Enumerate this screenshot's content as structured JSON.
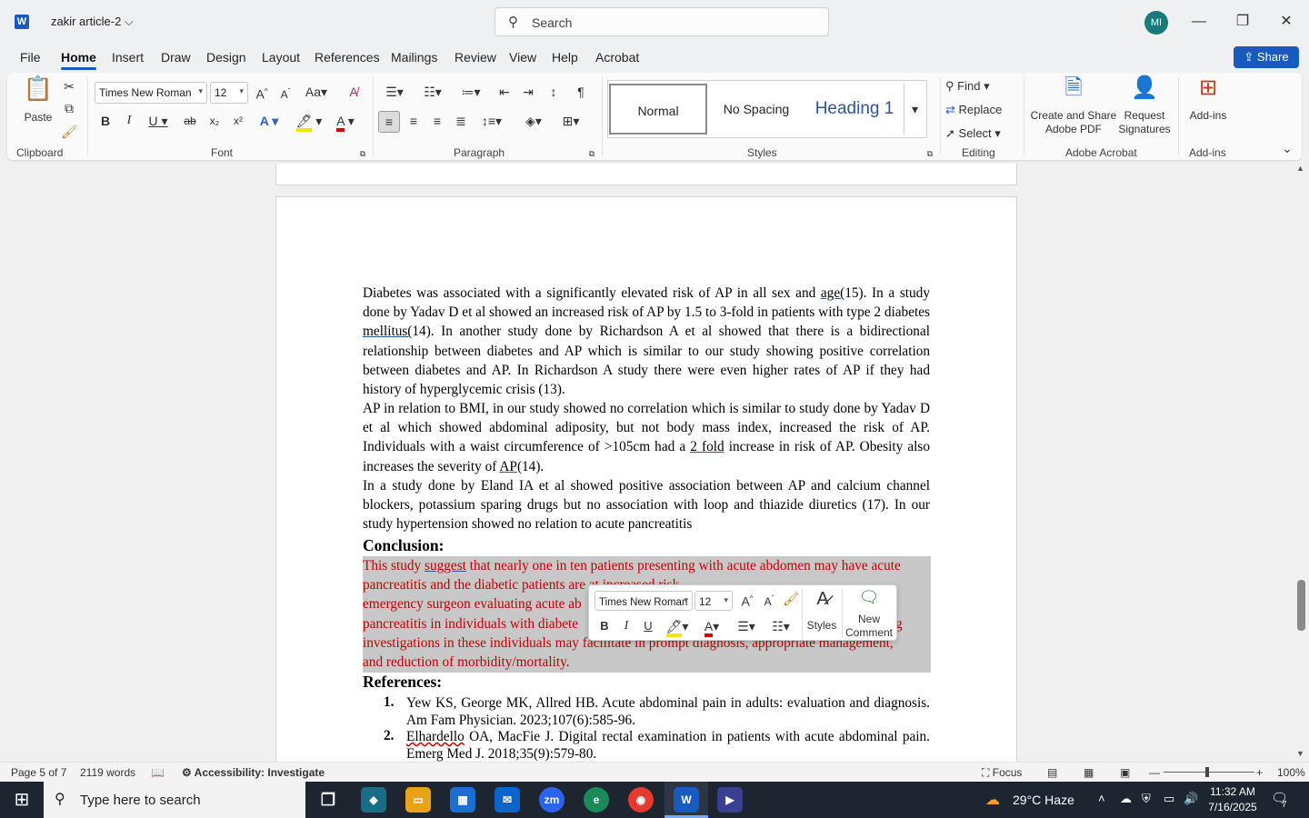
{
  "titlebar": {
    "doc_title": "zakir article-2",
    "search_placeholder": "Search",
    "avatar_initials": "MI"
  },
  "tabs": [
    "File",
    "Home",
    "Insert",
    "Draw",
    "Design",
    "Layout",
    "References",
    "Mailings",
    "Review",
    "View",
    "Help",
    "Acrobat"
  ],
  "share_label": "Share",
  "ribbon": {
    "clipboard": {
      "paste": "Paste",
      "group": "Clipboard"
    },
    "font": {
      "name": "Times New Roman",
      "size": "12",
      "group": "Font"
    },
    "paragraph": {
      "group": "Paragraph"
    },
    "styles": {
      "normal": "Normal",
      "nospacing": "No Spacing",
      "heading1": "Heading 1",
      "group": "Styles"
    },
    "editing": {
      "find": "Find",
      "replace": "Replace",
      "select": "Select",
      "group": "Editing"
    },
    "acrobat": {
      "create": "Create and Share Adobe PDF",
      "request": "Request Signatures",
      "group": "Adobe Acrobat"
    },
    "addins": {
      "label": "Add-ins",
      "group": "Add-ins"
    }
  },
  "document": {
    "p1": [
      "Diabetes was associated with a significantly elevated risk of AP in all sex and ",
      "age(",
      "15). In a study done by Yadav D et al showed an increased risk of AP by 1.5 to 3-fold in patients with type 2 diabetes ",
      "mellitus(",
      "14). In another study done by Richardson A et al showed that there is a bidirectional relationship between diabetes and AP which is similar to our study showing positive correlation between diabetes and AP. In Richardson A study there were even higher rates of AP if they had history of hyperglycemic crisis (13)."
    ],
    "p2": [
      "AP in relation to BMI, in our study showed no correlation which is similar to study done by Yadav D et al which showed abdominal adiposity, but not body mass index, increased the risk of AP. Individuals with a waist circumference of >105cm had a ",
      "2 fold",
      " increase in risk of AP. Obesity also increases the severity of ",
      "AP",
      "(14)."
    ],
    "p3": "In a study done by Eland IA et al showed positive association between AP and calcium channel blockers, potassium sparing drugs but no association with loop and thiazide diuretics (17). In our study hypertension showed no relation to acute pancreatitis",
    "conclusion_heading": "Conclusion:",
    "conclusion": {
      "l1a": "This study ",
      "l1b": "suggest",
      "l1c": " that nearly one in ten patients presenting with acute abdomen may have acute",
      "l2": "pancreatitis and the diabetic patients ar",
      "l2b": "e at increased risk",
      "l3": "emergency surgeon evaluating acute ab",
      "l4": "pancreatitis in individuals with diabete",
      "l4b": "g",
      "l5": "investigations in these individuals may ",
      "l5b": "facilitate in prompt diagnosis, appropriate management,",
      "l6": "and reduction of morbidity/mortality."
    },
    "references_heading": "References:",
    "references": [
      {
        "num": "1.",
        "text": "Yew KS, George MK, Allred HB. Acute abdominal pain in adults: evaluation and diagnosis. Am Fam Physician. 2023;107(6):585-96."
      },
      {
        "num": "2.",
        "text_a": "Elhardello",
        "text_b": " OA, MacFie J. Digital rectal examination in patients with acute abdominal pain. Emerg Med J. 2018;35(9):579-80."
      }
    ]
  },
  "mini_toolbar": {
    "font": "Times New Roman",
    "size": "12",
    "styles": "Styles",
    "new_comment": "New Comment"
  },
  "status": {
    "page": "Page 5 of 7",
    "words": "2119 words",
    "accessibility": "Accessibility: Investigate",
    "focus": "Focus",
    "zoom": "100%"
  },
  "taskbar": {
    "search_placeholder": "Type here to search",
    "weather": "29°C  Haze",
    "time": "11:32 AM",
    "date": "7/16/2025",
    "notifications": "7"
  }
}
